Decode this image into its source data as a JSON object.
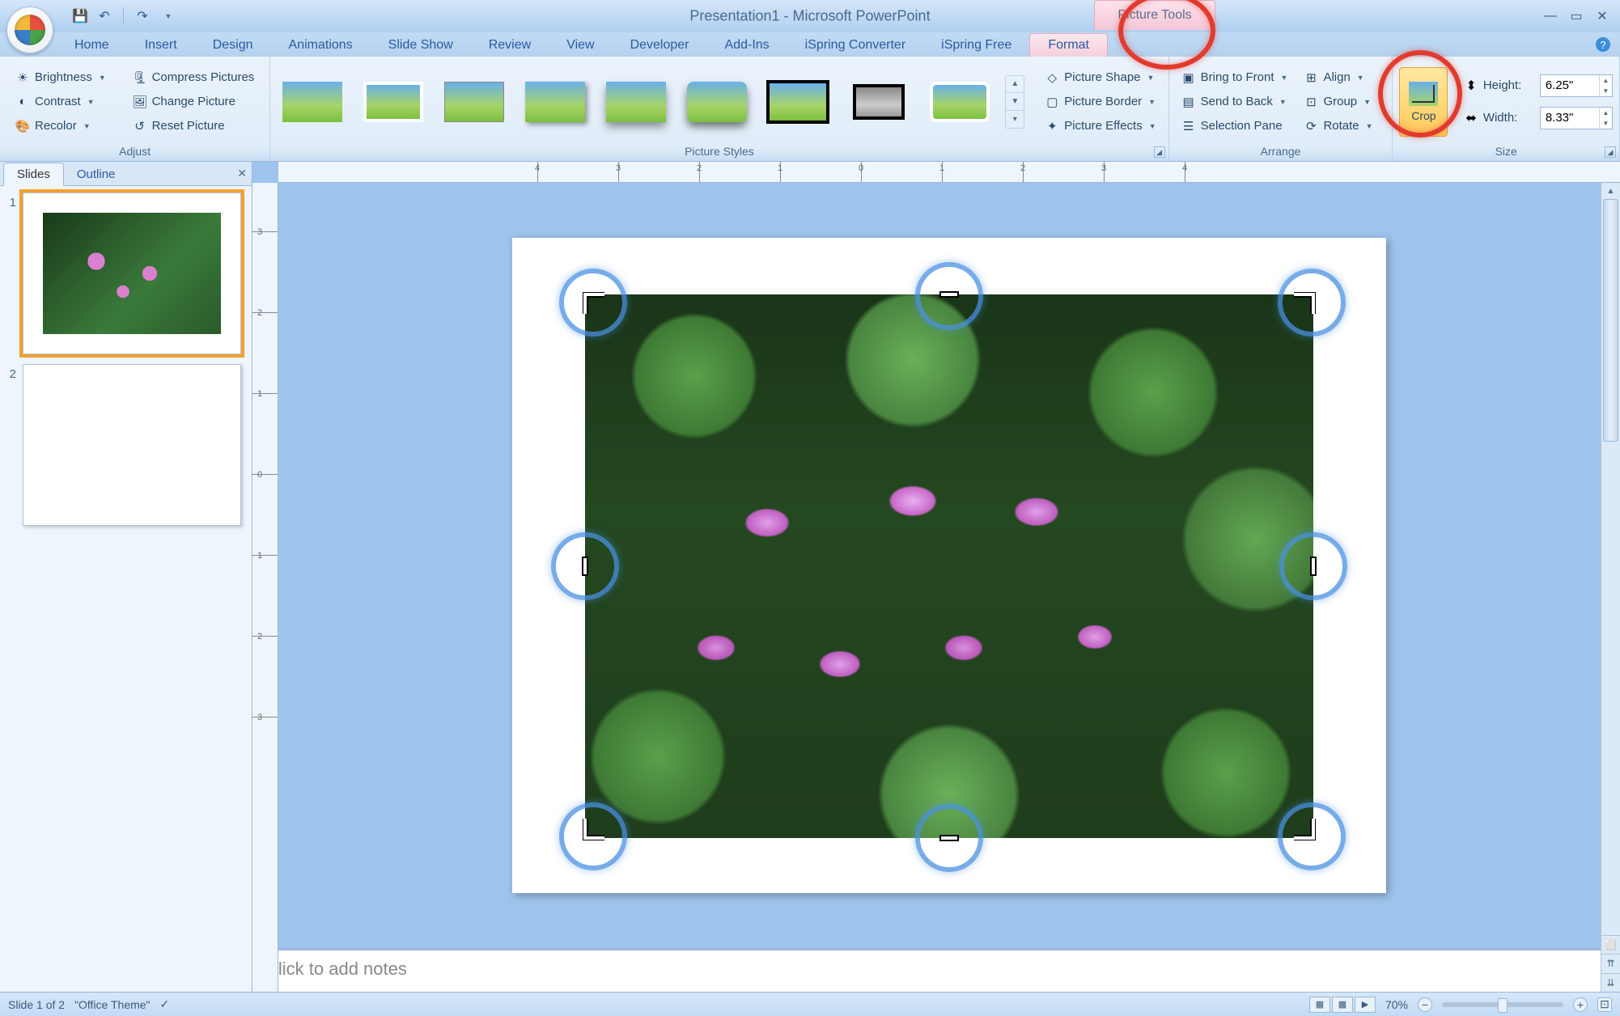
{
  "app": {
    "title_doc": "Presentation1",
    "title_app": "- Microsoft PowerPoint",
    "context_tool": "Picture Tools"
  },
  "qat": {
    "save": "save-icon",
    "undo": "undo-icon",
    "redo": "redo-icon"
  },
  "tabs": [
    "Home",
    "Insert",
    "Design",
    "Animations",
    "Slide Show",
    "Review",
    "View",
    "Developer",
    "Add-Ins",
    "iSpring Converter",
    "iSpring Free",
    "Format"
  ],
  "active_tab_index": 11,
  "ribbon": {
    "adjust": {
      "label": "Adjust",
      "brightness": "Brightness",
      "contrast": "Contrast",
      "recolor": "Recolor",
      "compress": "Compress Pictures",
      "change": "Change Picture",
      "reset": "Reset Picture"
    },
    "styles": {
      "label": "Picture Styles",
      "shape": "Picture Shape",
      "border": "Picture Border",
      "effects": "Picture Effects"
    },
    "arrange": {
      "label": "Arrange",
      "front": "Bring to Front",
      "back": "Send to Back",
      "selpane": "Selection Pane",
      "align": "Align",
      "group": "Group",
      "rotate": "Rotate"
    },
    "size": {
      "label": "Size",
      "crop": "Crop",
      "height_label": "Height:",
      "width_label": "Width:",
      "height_value": "6.25\"",
      "width_value": "8.33\""
    }
  },
  "panel": {
    "slides_tab": "Slides",
    "outline_tab": "Outline",
    "thumbs": [
      {
        "num": "1",
        "selected": true,
        "has_image": true
      },
      {
        "num": "2",
        "selected": false,
        "has_image": false
      }
    ]
  },
  "notes": {
    "placeholder": "Click to add notes"
  },
  "status": {
    "slide": "Slide 1 of 2",
    "theme": "\"Office Theme\"",
    "zoom": "70%"
  },
  "ruler_h_marks": [
    "",
    "4",
    "3",
    "2",
    "1",
    "0",
    "1",
    "2",
    "3",
    "4",
    ""
  ]
}
